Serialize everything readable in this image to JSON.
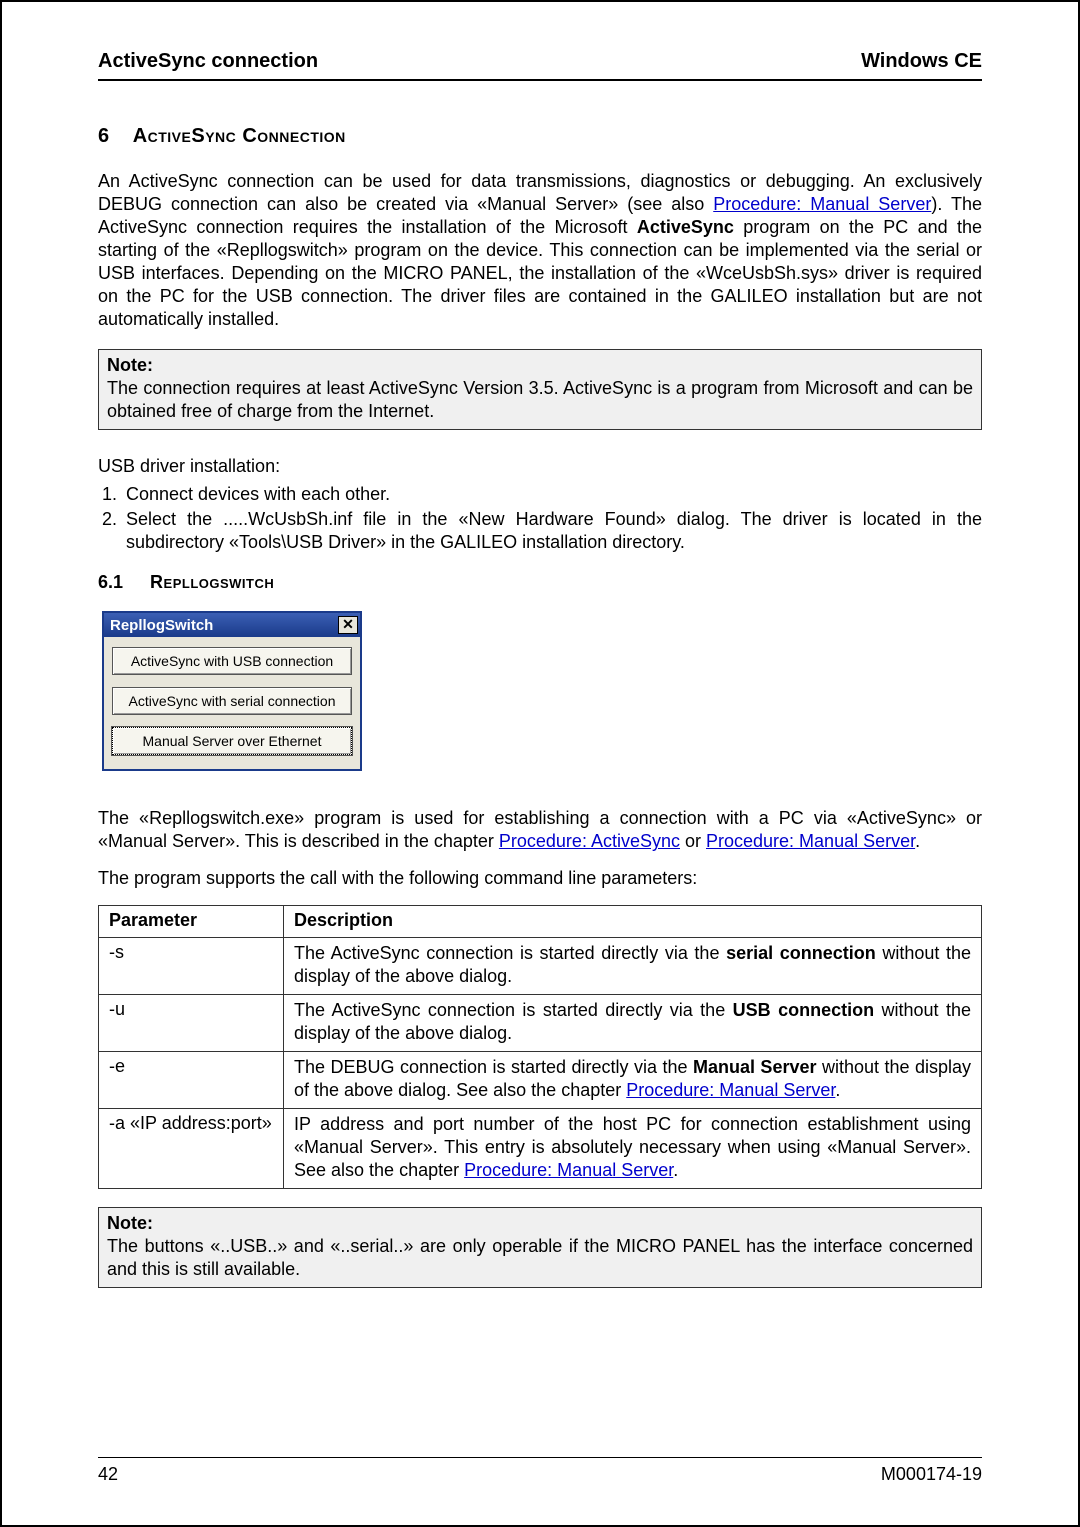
{
  "header": {
    "left": "ActiveSync connection",
    "right": "Windows CE"
  },
  "section": {
    "num": "6",
    "title": "ActiveSync Connection"
  },
  "intro": {
    "p1a": "An ActiveSync connection can be used for data transmissions, diagnostics or debugging. An exclusively DEBUG connection can also be created via «Manual Server» (see also ",
    "link1": "Procedure: Manual Server",
    "p1b": "). The ActiveSync connection requires the installation of the Microsoft ",
    "boldAS": "ActiveSync",
    "p1c": " program on the PC and the starting of the «Repllogswitch» program on the device. This connection can be implemented via the serial or USB interfaces. Depending on the MICRO PANEL, the installation of the «WceUsbSh.sys» driver is required on the PC for the USB connection. The driver files are contained in the GALILEO installation but are not automatically installed."
  },
  "note1": {
    "title": "Note:",
    "body": "The connection requires at least ActiveSync Version 3.5. ActiveSync is a program from Microsoft and can be obtained free of charge from the Internet."
  },
  "usb": {
    "heading": "USB driver installation:",
    "steps": [
      "Connect devices with each other.",
      "Select the .....WcUsbSh.inf file in the «New Hardware Found» dialog. The driver is located in the subdirectory «Tools\\USB Driver» in the GALILEO installation directory."
    ]
  },
  "subsection": {
    "num": "6.1",
    "title": "Repllogswitch"
  },
  "dialog": {
    "title": "RepllogSwitch",
    "close": "✕",
    "btn_usb": "ActiveSync with USB connection",
    "btn_serial": "ActiveSync with serial connection",
    "btn_manual": "Manual Server over Ethernet"
  },
  "after_dialog": {
    "p1a": "The «Repllogswitch.exe» program is used for establishing a connection with a PC via «ActiveSync» or «Manual Server». This is described in the chapter ",
    "link_as": "Procedure: ActiveSync",
    "or": " or ",
    "link_ms": "Procedure: Manual Server",
    "period": ".",
    "p2": "The program supports the call with the following command line parameters:"
  },
  "table": {
    "headers": {
      "param": "Parameter",
      "desc": "Description"
    },
    "rows": [
      {
        "param": "-s",
        "d1": "The ActiveSync connection is started directly via the ",
        "bold": "serial connection",
        "d2": " without the display of the above dialog."
      },
      {
        "param": "-u",
        "d1": "The ActiveSync connection is started directly via the ",
        "bold": "USB connection",
        "d2": " without the display of the above dialog."
      },
      {
        "param": "-e",
        "d1": "The DEBUG connection is started directly via the ",
        "bold": "Manual Server",
        "d2": " without the display of the above dialog. See also the chapter ",
        "link": "Procedure: Manual Server",
        "d3": "."
      },
      {
        "param": "-a «IP address:port»",
        "d1": "IP address and port number of the host PC for connection establishment using «Manual Server». This entry is absolutely necessary when using «Manual Server». See also the chapter ",
        "link": "Procedure: Manual Server",
        "d3": "."
      }
    ]
  },
  "note2": {
    "title": "Note:",
    "body": "The buttons «..USB..» and «..serial..» are only operable if the MICRO PANEL has the interface concerned and this is still available."
  },
  "footer": {
    "left": "42",
    "right": "M000174-19"
  }
}
